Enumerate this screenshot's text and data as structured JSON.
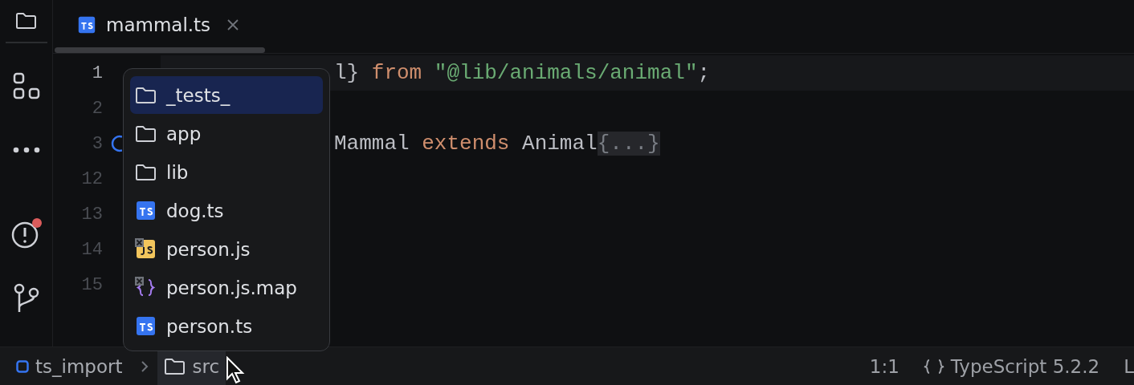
{
  "tab": {
    "label": "mammal.ts",
    "selected": true
  },
  "editor": {
    "lines": [
      {
        "number": "1",
        "kind": "plain",
        "current": true,
        "segments": [
          {
            "kind": "plain",
            "text": "l} "
          },
          {
            "kind": "keyword",
            "text": "from "
          },
          {
            "kind": "string",
            "text": "\"@lib/animals/animal\""
          },
          {
            "kind": "plain",
            "text": ";"
          }
        ]
      },
      {
        "number": "2",
        "kind": "plain",
        "current": false
      },
      {
        "number": "3",
        "kind": "override",
        "current": false,
        "segments": [
          {
            "kind": "plain",
            "text": "Mammal "
          },
          {
            "kind": "keyword",
            "text": "extends "
          },
          {
            "kind": "plain",
            "text": "Animal"
          },
          {
            "kind": "folded",
            "text": "{...}"
          }
        ]
      },
      {
        "number": "12",
        "kind": "plain",
        "current": false
      },
      {
        "number": "13",
        "kind": "plain",
        "current": false
      },
      {
        "number": "14",
        "kind": "plain",
        "current": false
      },
      {
        "number": "15",
        "kind": "plain",
        "current": false
      }
    ]
  },
  "popup": {
    "items": [
      {
        "kind": "folder",
        "label": "_tests_",
        "selected": true,
        "excluded": false
      },
      {
        "kind": "folder",
        "label": "app",
        "selected": false,
        "excluded": false
      },
      {
        "kind": "folder",
        "label": "lib",
        "selected": false,
        "excluded": false
      },
      {
        "kind": "ts",
        "label": "dog.ts",
        "selected": false,
        "excluded": false
      },
      {
        "kind": "js",
        "label": "person.js",
        "selected": false,
        "excluded": true
      },
      {
        "kind": "map",
        "label": "person.js.map",
        "selected": false,
        "excluded": true
      },
      {
        "kind": "ts",
        "label": "person.ts",
        "selected": false,
        "excluded": false
      }
    ]
  },
  "status_bar": {
    "breadcrumbs": [
      {
        "kind": "module",
        "label": "ts_import",
        "selected": false
      },
      {
        "kind": "folder",
        "label": "src",
        "selected": true
      }
    ],
    "position": "1:1",
    "language": "TypeScript 5.2.2",
    "cut_item": "L"
  },
  "sidebar": {
    "problems_badge": true
  }
}
